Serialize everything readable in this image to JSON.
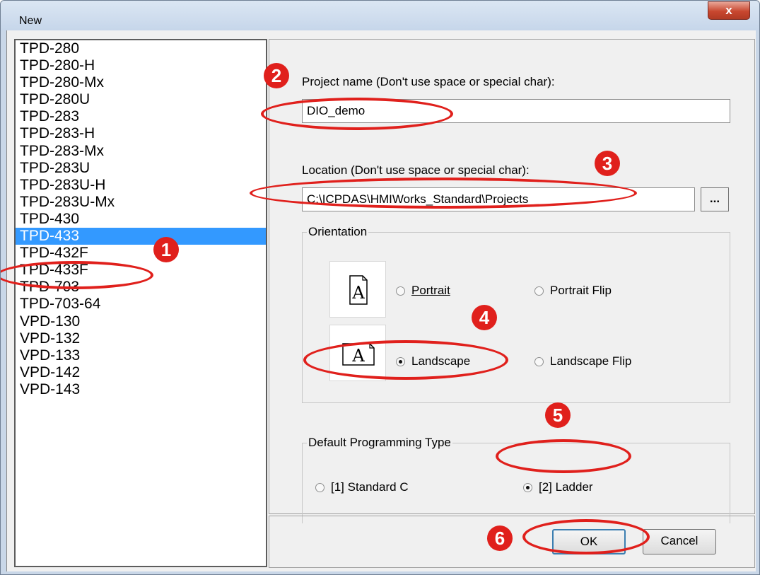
{
  "window": {
    "title": "New",
    "close_label": "x"
  },
  "device_list": {
    "items": [
      "TPD-280",
      "TPD-280-H",
      "TPD-280-Mx",
      "TPD-280U",
      "TPD-283",
      "TPD-283-H",
      "TPD-283-Mx",
      "TPD-283U",
      "TPD-283U-H",
      "TPD-283U-Mx",
      "TPD-430",
      "TPD-433",
      "TPD-432F",
      "TPD-433F",
      "TPD-703",
      "TPD-703-64",
      "VPD-130",
      "VPD-132",
      "VPD-133",
      "VPD-142",
      "VPD-143"
    ],
    "selected": "TPD-433"
  },
  "project_name": {
    "label": "Project name (Don't use space or special char):",
    "value": "DIO_demo"
  },
  "location": {
    "label": "Location (Don't use space or special char):",
    "value": "C:\\ICPDAS\\HMIWorks_Standard\\Projects",
    "browse_label": "..."
  },
  "orientation": {
    "title": "Orientation",
    "options": [
      "Portrait",
      "Portrait Flip",
      "Landscape",
      "Landscape Flip"
    ],
    "selected": "Landscape",
    "icon_glyph": "A"
  },
  "programming_type": {
    "title": "Default Programming Type",
    "options": [
      "[1] Standard C",
      "[2] Ladder"
    ],
    "selected": "[2] Ladder"
  },
  "buttons": {
    "ok": "OK",
    "cancel": "Cancel"
  },
  "annotations": [
    "1",
    "2",
    "3",
    "4",
    "5",
    "6"
  ],
  "colors": {
    "highlight": "#e0201c",
    "selection": "#3399ff"
  }
}
